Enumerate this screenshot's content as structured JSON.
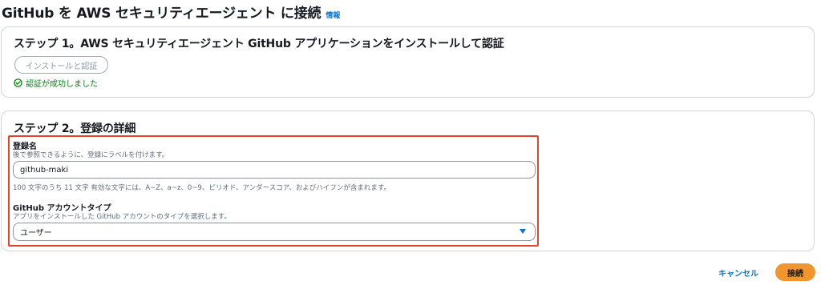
{
  "header": {
    "title": "GitHub を AWS セキュリティエージェント に接続",
    "info_link": "情報"
  },
  "step1": {
    "title": "ステップ 1。AWS セキュリティエージェント GitHub アプリケーションをインストールして認証",
    "install_button": "インストールと認証",
    "status_icon": "check-circle-icon",
    "status_text": "認証が成功しました"
  },
  "step2": {
    "title": "ステップ 2。登録の詳細",
    "registration_name": {
      "label": "登録名",
      "description": "後で参照できるように、登録にラベルを付けます。",
      "value": "github-maki",
      "constraint": "100 文字のうち 11 文字 有効な文字には、A~Z、a~z、0~9、ピリオド、アンダースコア、およびハイフンが含まれます。"
    },
    "account_type": {
      "label": "GitHub アカウントタイプ",
      "description": "アプリをインストールした GitHub アカウントのタイプを選択します。",
      "selected": "ユーザー",
      "caret_icon": "caret-down-icon"
    }
  },
  "footer": {
    "cancel_label": "キャンセル",
    "connect_label": "接続"
  },
  "colors": {
    "link": "#0972d3",
    "success": "#037f0c",
    "primary_button": "#f0962e",
    "highlight_border": "#e4442b"
  }
}
